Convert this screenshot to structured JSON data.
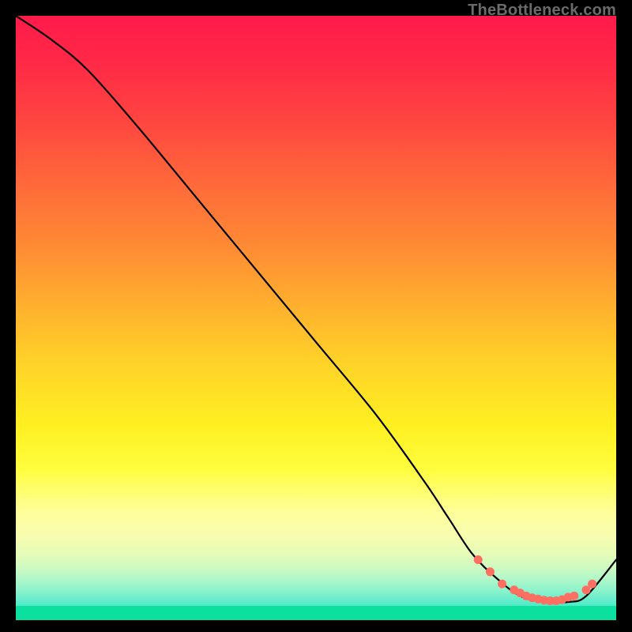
{
  "attribution": "TheBottleneck.com",
  "chart_data": {
    "type": "line",
    "title": "",
    "xlabel": "",
    "ylabel": "",
    "xlim": [
      0,
      100
    ],
    "ylim": [
      0,
      100
    ],
    "series": [
      {
        "name": "curve",
        "x": [
          0,
          6,
          12,
          20,
          30,
          40,
          50,
          60,
          68,
          72,
          76,
          80,
          84,
          88,
          92,
          95,
          100
        ],
        "y": [
          100,
          96,
          91,
          82,
          70,
          58,
          46,
          34,
          23,
          17,
          11,
          7,
          4,
          3,
          3,
          4,
          10
        ],
        "color": "#000000"
      }
    ],
    "points": {
      "name": "markers",
      "color": "#ff6f61",
      "x": [
        77,
        79,
        81,
        83,
        84,
        85,
        86,
        87,
        88,
        89,
        90,
        91,
        92,
        93,
        95,
        96
      ],
      "y": [
        10,
        8,
        6,
        5,
        4.5,
        4,
        3.7,
        3.5,
        3.3,
        3.2,
        3.2,
        3.4,
        3.8,
        4,
        5,
        6
      ]
    }
  }
}
